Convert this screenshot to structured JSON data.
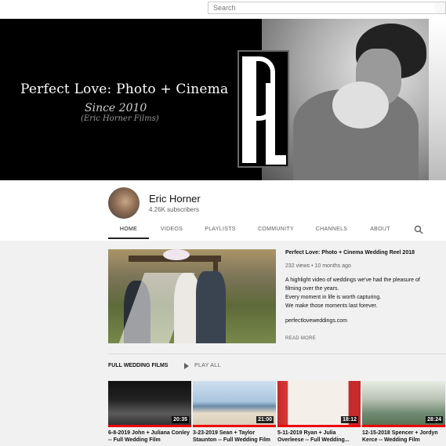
{
  "search": {
    "placeholder": "Search"
  },
  "banner": {
    "title": "Perfect Love: Photo + Cinema",
    "since": "Since 2010",
    "subtitle": "(Eric Horner Films)",
    "logo_text": "PL"
  },
  "channel": {
    "name": "Eric Horner",
    "subscribers": "4.26K subscribers"
  },
  "tabs": [
    {
      "label": "HOME",
      "active": true
    },
    {
      "label": "VIDEOS"
    },
    {
      "label": "PLAYLISTS"
    },
    {
      "label": "COMMUNITY"
    },
    {
      "label": "CHANNELS"
    },
    {
      "label": "ABOUT"
    }
  ],
  "feature": {
    "title": "Perfect Love: Photo + Cinema Wedding Reel 2018",
    "meta": "232 views • 10 months ago",
    "description": [
      "A highlight video of weddings we've had the pleasure of filming over the years.",
      "Every moment in life is worth capturing.",
      "We make those moments last forever."
    ],
    "link": "perfectloveweddings.com",
    "read_more": "READ MORE"
  },
  "section": {
    "title": "FULL WEDDING FILMS",
    "play_all": "PLAY ALL"
  },
  "videos": [
    {
      "title": "6-8-2019 John + Juliana Conley -- Full Wedding Film",
      "duration": "20:35",
      "watched": 1.0
    },
    {
      "title": "3-23-2019 Sean + Taylor Staunton -- Full Wedding Film",
      "duration": "21:00",
      "watched": 1.0
    },
    {
      "title": "5-11-2019 Ryan + Julia Overleese -- Full Wedding...",
      "duration": "18:12",
      "watched": 1.0
    },
    {
      "title": "12-15-2018 Spencer + Jordyn Kerce -- Wedding Film",
      "duration": "28:24",
      "watched": 1.0
    }
  ],
  "icons": {
    "search": "search-icon",
    "play": "play-icon"
  }
}
